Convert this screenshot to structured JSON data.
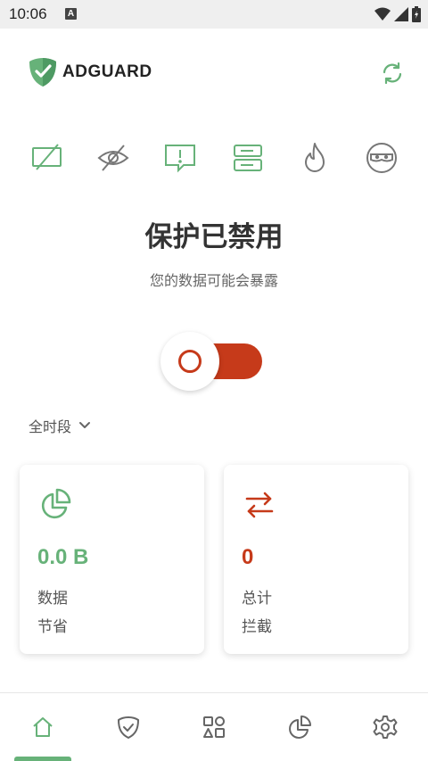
{
  "status_bar": {
    "time": "10:06",
    "notification_badge": "A"
  },
  "header": {
    "brand_name": "ADGUARD",
    "refresh_icon": "refresh-icon"
  },
  "features": [
    {
      "name": "ad-blocking",
      "icon": "crossed-screen-icon"
    },
    {
      "name": "tracking-protection",
      "icon": "crossed-eye-icon"
    },
    {
      "name": "annoyance-blocking",
      "icon": "alert-bubble-icon"
    },
    {
      "name": "dns-protection",
      "icon": "server-icon"
    },
    {
      "name": "firewall",
      "icon": "flame-icon"
    },
    {
      "name": "stealth-mode",
      "icon": "mask-icon"
    }
  ],
  "protection": {
    "title": "保护已禁用",
    "subtitle": "您的数据可能会暴露",
    "enabled": false
  },
  "period": {
    "label": "全时段"
  },
  "cards": [
    {
      "value": "0.0 B",
      "label_line1": "数据",
      "label_line2": "节省",
      "icon": "pie-chart-icon",
      "color": "#67b279"
    },
    {
      "value": "0",
      "label_line1": "总计",
      "label_line2": "拦截",
      "icon": "transfer-arrows-icon",
      "color": "#c63a1a"
    }
  ],
  "bottom_nav": [
    {
      "name": "home",
      "icon": "home-icon",
      "active": true
    },
    {
      "name": "protection",
      "icon": "shield-check-icon",
      "active": false
    },
    {
      "name": "apps",
      "icon": "apps-grid-icon",
      "active": false
    },
    {
      "name": "statistics",
      "icon": "pie-chart-icon",
      "active": false
    },
    {
      "name": "settings",
      "icon": "gear-icon",
      "active": false
    }
  ],
  "colors": {
    "accent_green": "#67b279",
    "danger_red": "#c63a1a",
    "icon_gray": "#777777"
  }
}
